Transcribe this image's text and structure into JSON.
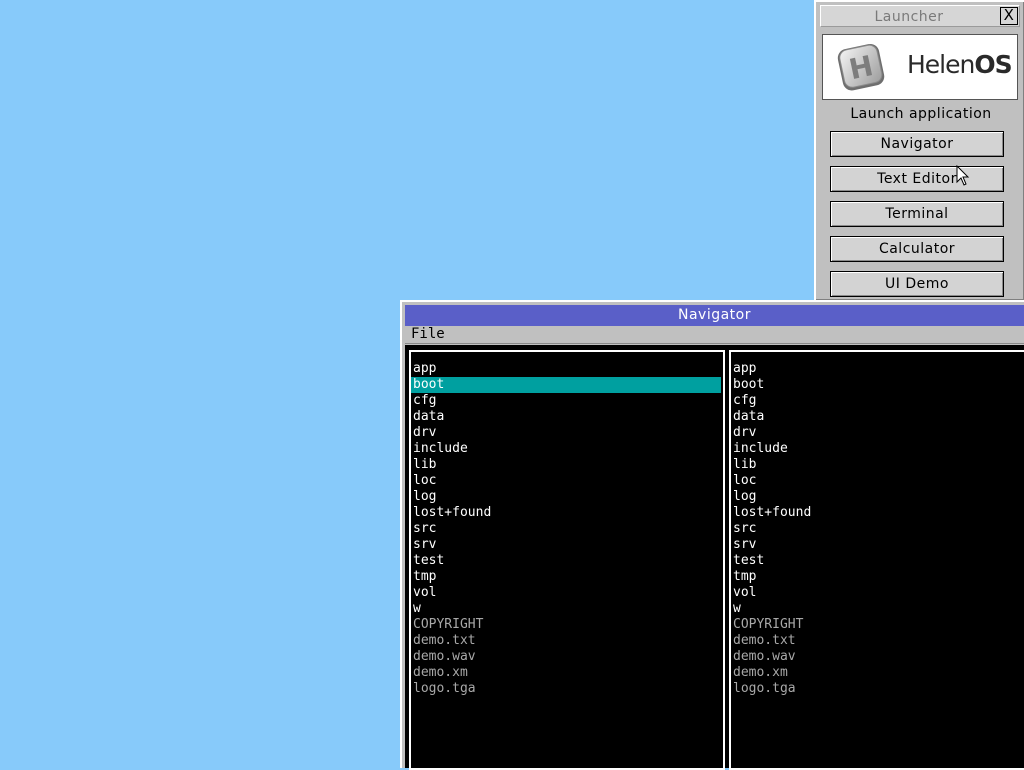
{
  "launcher": {
    "title": "Launcher",
    "close_label": "X",
    "logo": {
      "prefix": "Helen",
      "suffix": "OS",
      "badge_letter": "H"
    },
    "caption": "Launch application",
    "buttons": [
      {
        "label": "Navigator"
      },
      {
        "label": "Text Editor"
      },
      {
        "label": "Terminal"
      },
      {
        "label": "Calculator"
      },
      {
        "label": "UI Demo"
      }
    ]
  },
  "navigator": {
    "title": "Navigator",
    "menu": {
      "file": "File"
    },
    "left_panel": {
      "selected_index": 1,
      "entries": [
        {
          "name": "app",
          "kind": "dir"
        },
        {
          "name": "boot",
          "kind": "dir"
        },
        {
          "name": "cfg",
          "kind": "dir"
        },
        {
          "name": "data",
          "kind": "dir"
        },
        {
          "name": "drv",
          "kind": "dir"
        },
        {
          "name": "include",
          "kind": "dir"
        },
        {
          "name": "lib",
          "kind": "dir"
        },
        {
          "name": "loc",
          "kind": "dir"
        },
        {
          "name": "log",
          "kind": "dir"
        },
        {
          "name": "lost+found",
          "kind": "dir"
        },
        {
          "name": "src",
          "kind": "dir"
        },
        {
          "name": "srv",
          "kind": "dir"
        },
        {
          "name": "test",
          "kind": "dir"
        },
        {
          "name": "tmp",
          "kind": "dir"
        },
        {
          "name": "vol",
          "kind": "dir"
        },
        {
          "name": "w",
          "kind": "dir"
        },
        {
          "name": "COPYRIGHT",
          "kind": "file"
        },
        {
          "name": "demo.txt",
          "kind": "file"
        },
        {
          "name": "demo.wav",
          "kind": "file"
        },
        {
          "name": "demo.xm",
          "kind": "file"
        },
        {
          "name": "logo.tga",
          "kind": "file"
        }
      ]
    },
    "right_panel": {
      "entries": [
        {
          "name": "app",
          "kind": "dir"
        },
        {
          "name": "boot",
          "kind": "dir"
        },
        {
          "name": "cfg",
          "kind": "dir"
        },
        {
          "name": "data",
          "kind": "dir"
        },
        {
          "name": "drv",
          "kind": "dir"
        },
        {
          "name": "include",
          "kind": "dir"
        },
        {
          "name": "lib",
          "kind": "dir"
        },
        {
          "name": "loc",
          "kind": "dir"
        },
        {
          "name": "log",
          "kind": "dir"
        },
        {
          "name": "lost+found",
          "kind": "dir"
        },
        {
          "name": "src",
          "kind": "dir"
        },
        {
          "name": "srv",
          "kind": "dir"
        },
        {
          "name": "test",
          "kind": "dir"
        },
        {
          "name": "tmp",
          "kind": "dir"
        },
        {
          "name": "vol",
          "kind": "dir"
        },
        {
          "name": "w",
          "kind": "dir"
        },
        {
          "name": "COPYRIGHT",
          "kind": "file"
        },
        {
          "name": "demo.txt",
          "kind": "file"
        },
        {
          "name": "demo.wav",
          "kind": "file"
        },
        {
          "name": "demo.xm",
          "kind": "file"
        },
        {
          "name": "logo.tga",
          "kind": "file"
        }
      ]
    }
  },
  "colors": {
    "desktop": "#87cafa",
    "title_active": "#5a5fc8",
    "selection": "#00a0a0"
  }
}
